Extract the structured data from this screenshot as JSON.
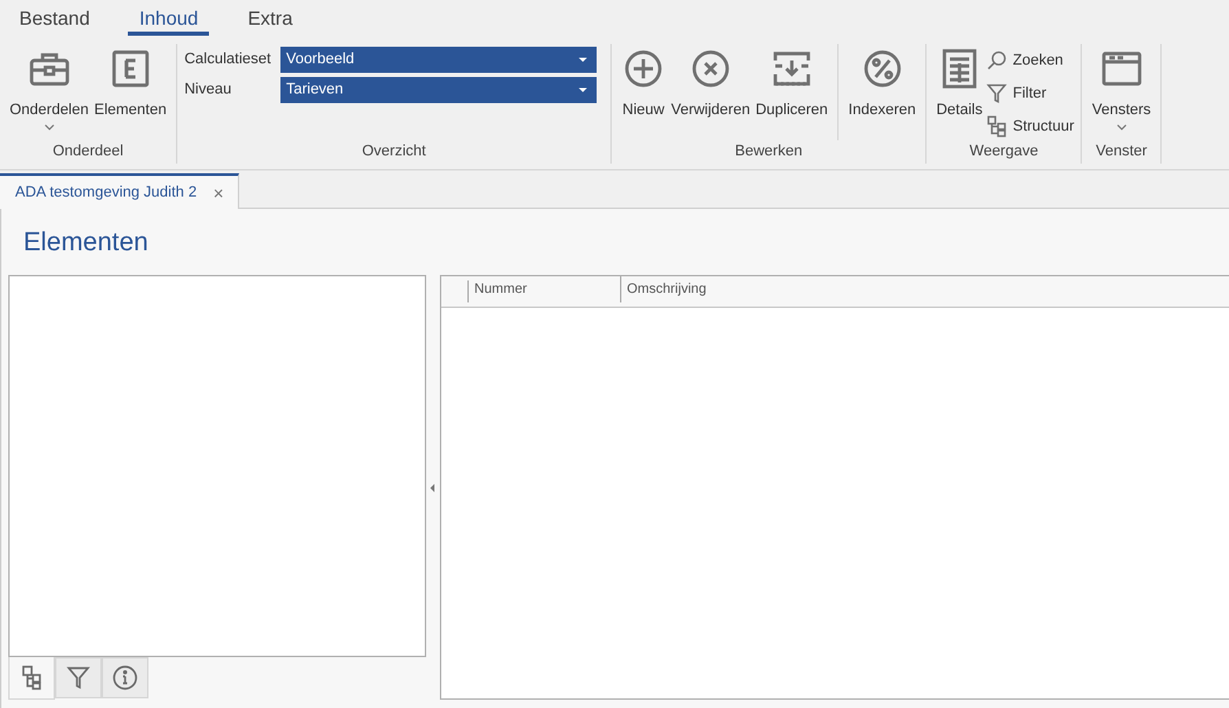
{
  "menu_tabs": [
    {
      "label": "Bestand",
      "selected": false
    },
    {
      "label": "Inhoud",
      "selected": true
    },
    {
      "label": "Extra",
      "selected": false
    }
  ],
  "ribbon": {
    "groups": [
      {
        "title": "Onderdeel",
        "items": [
          {
            "kind": "large",
            "label": "Onderdelen",
            "has_menu": true
          },
          {
            "kind": "large",
            "label": "Elementen",
            "has_menu": false
          }
        ]
      },
      {
        "title": "Overzicht",
        "items": [
          {
            "kind": "combo",
            "label": "Calculatieset",
            "value": "Voorbeeld"
          },
          {
            "kind": "combo",
            "label": "Niveau",
            "value": "Tarieven"
          }
        ]
      },
      {
        "title": "Bewerken",
        "items": [
          {
            "kind": "large",
            "label": "Nieuw",
            "has_menu": false
          },
          {
            "kind": "large",
            "label": "Verwijderen",
            "has_menu": false
          },
          {
            "kind": "large",
            "label": "Dupliceren",
            "has_menu": false
          },
          {
            "kind": "separator"
          },
          {
            "kind": "large",
            "label": "Indexeren",
            "has_menu": false
          }
        ]
      },
      {
        "title": "Weergave",
        "items": [
          {
            "kind": "large",
            "label": "Details",
            "has_menu": false
          },
          {
            "kind": "small",
            "label": "Zoeken"
          },
          {
            "kind": "small",
            "label": "Filter"
          },
          {
            "kind": "small",
            "label": "Structuur"
          }
        ]
      },
      {
        "title": "Venster",
        "items": [
          {
            "kind": "large",
            "label": "Vensters",
            "has_menu": true
          }
        ]
      }
    ]
  },
  "document_tabs": [
    {
      "label": "ADA testomgeving Judith 2",
      "close": "×",
      "selected": true
    }
  ],
  "page_title": "Elementen",
  "side_panel": {
    "tabs": [
      {
        "selected": true
      },
      {
        "selected": false
      },
      {
        "selected": false
      }
    ]
  },
  "table": {
    "columns": [
      "Nummer",
      "Omschrijving"
    ]
  }
}
